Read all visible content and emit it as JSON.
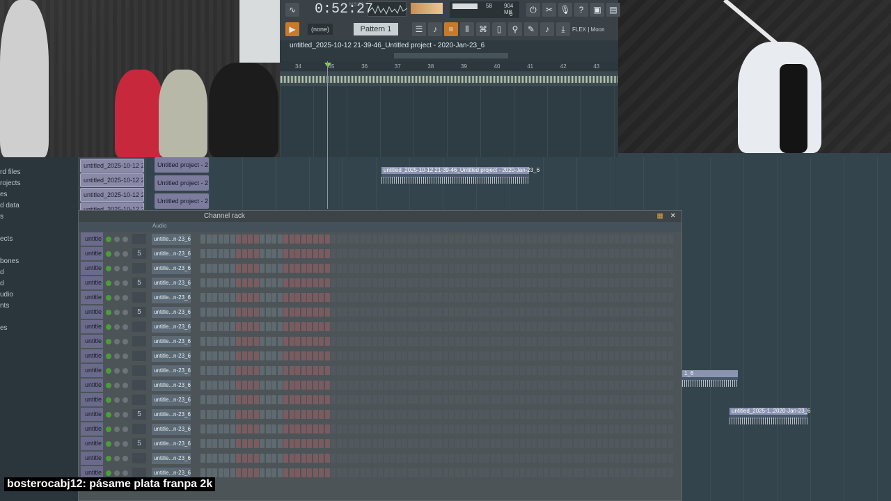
{
  "toolbar": {
    "time": "0:52:27",
    "time_unit": "M:S:CS",
    "memory": "904 MB",
    "cpu": "58",
    "cpu_sub": "0",
    "pattern_none": "(none)",
    "pattern": "Pattern 1",
    "flex_label": "FLEX | Moon",
    "project_title": "untitled_2025-10-12 21-39-46_Untitled project - 2020-Jan-23_6"
  },
  "ruler": [
    "34",
    "35",
    "36",
    "37",
    "38",
    "39",
    "40",
    "41",
    "42",
    "43"
  ],
  "browser": {
    "items": [
      "rd files",
      "rojects",
      "es",
      "d data",
      "s",
      "",
      "ects",
      "",
      "bones",
      "d",
      "d",
      "udio",
      "nts",
      "",
      "es"
    ]
  },
  "playlist": {
    "tracks": [
      "untitled_2025-10-12 21-..",
      "untitled_2025-10-12 21-..",
      "untitled_2025-10-12 21-..",
      "untitled_2025-10-12 21-.."
    ],
    "patterns": [
      "Untitled project - 2",
      "Untitled project - 2",
      "Untitled project - 2"
    ],
    "clip_main": "untitled_2025-10-12 21-39-46_Untitled project - 2020-Jan-23_6",
    "clip_right1": "1_6",
    "clip_right2": "untitled_2025-1..2020-Jan-23_6"
  },
  "channel_rack": {
    "title": "Channel rack",
    "filter": "Audio",
    "channels": [
      {
        "num": "",
        "name": "untitle...n-23_6"
      },
      {
        "num": "5",
        "name": "untitle...n-23_6"
      },
      {
        "num": "",
        "name": "untitle...n-23_6"
      },
      {
        "num": "5",
        "name": "untitle...n-23_6"
      },
      {
        "num": "",
        "name": "untitle...n-23_6"
      },
      {
        "num": "5",
        "name": "untitle...n-23_6"
      },
      {
        "num": "",
        "name": "untitle...n-23_6"
      },
      {
        "num": "",
        "name": "untitle...n-23_6"
      },
      {
        "num": "",
        "name": "untitle...n-23_6"
      },
      {
        "num": "",
        "name": "untitle...n-23_6"
      },
      {
        "num": "",
        "name": "untitle...n-23_6"
      },
      {
        "num": "",
        "name": "untitle...n-23_6"
      },
      {
        "num": "5",
        "name": "untitle...n-23_6"
      },
      {
        "num": "",
        "name": "untitle...n-23_6"
      },
      {
        "num": "5",
        "name": "untitle...n-23_6"
      },
      {
        "num": "",
        "name": "untitle...n-23_6"
      },
      {
        "num": "",
        "name": "untitle...n-23_6"
      }
    ],
    "left_labels": [
      "untitle",
      "untitle",
      "untitle",
      "untitle",
      "untitle",
      "untitle",
      "untitle",
      "untitle",
      "untitle",
      "untitle",
      "untitle",
      "untitle",
      "untitle",
      "untitle",
      "untitle",
      "untitle",
      "untitle"
    ]
  },
  "chat": {
    "user": "bosterocabj12",
    "message": ": pásame plata franpa 2k"
  }
}
